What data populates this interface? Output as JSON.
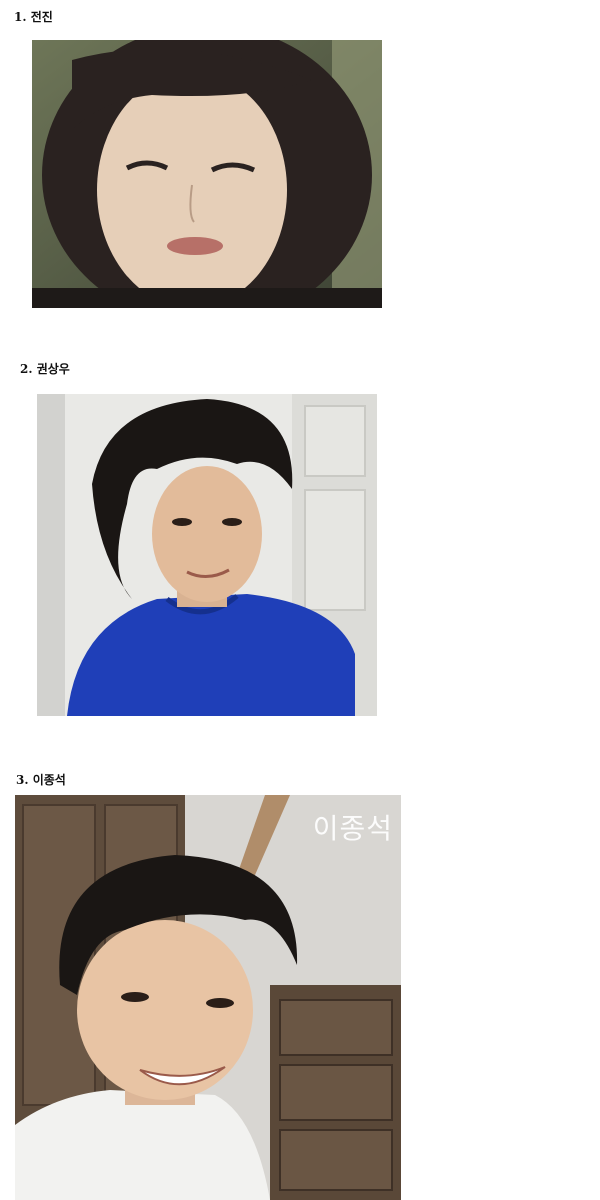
{
  "entries": [
    {
      "caption": "1. 전진"
    },
    {
      "caption": "2. 권상우"
    },
    {
      "caption": "3. 이종석",
      "watermark": "이종석"
    }
  ],
  "colors": {
    "page_background": "#ffffff",
    "photo1_background": "#6d7458",
    "photo2_wall": "#e9e9e6",
    "photo2_shirt": "#1f3fb8",
    "photo3_background": "#6a5a48",
    "hair": "#1a1614",
    "skin": "#e8c9b0"
  }
}
